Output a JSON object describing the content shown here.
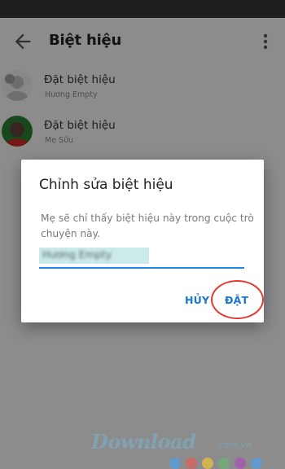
{
  "app_bar": {
    "title": "Biệt hiệu"
  },
  "list": {
    "items": [
      {
        "title": "Đặt biệt hiệu",
        "subtitle": "Hương Empty"
      },
      {
        "title": "Đặt biệt hiệu",
        "subtitle": "Mẹ Sữu"
      }
    ]
  },
  "dialog": {
    "title": "Chỉnh sửa biệt hiệu",
    "description": "Mẹ sẽ chỉ thấy biệt hiệu này trong cuộc trò chuyện này.",
    "input_value": "Hương Empty",
    "cancel_label": "HỦY",
    "set_label": "ĐẶT"
  },
  "watermark": {
    "brand": "Download",
    "domain": ".com.vn"
  },
  "colors": {
    "accent": "#1976d2",
    "highlight_circle": "#e53935",
    "input_underline": "#1e88e5"
  },
  "icons": {
    "back": "arrow-back-icon",
    "more": "more-vert-icon"
  }
}
